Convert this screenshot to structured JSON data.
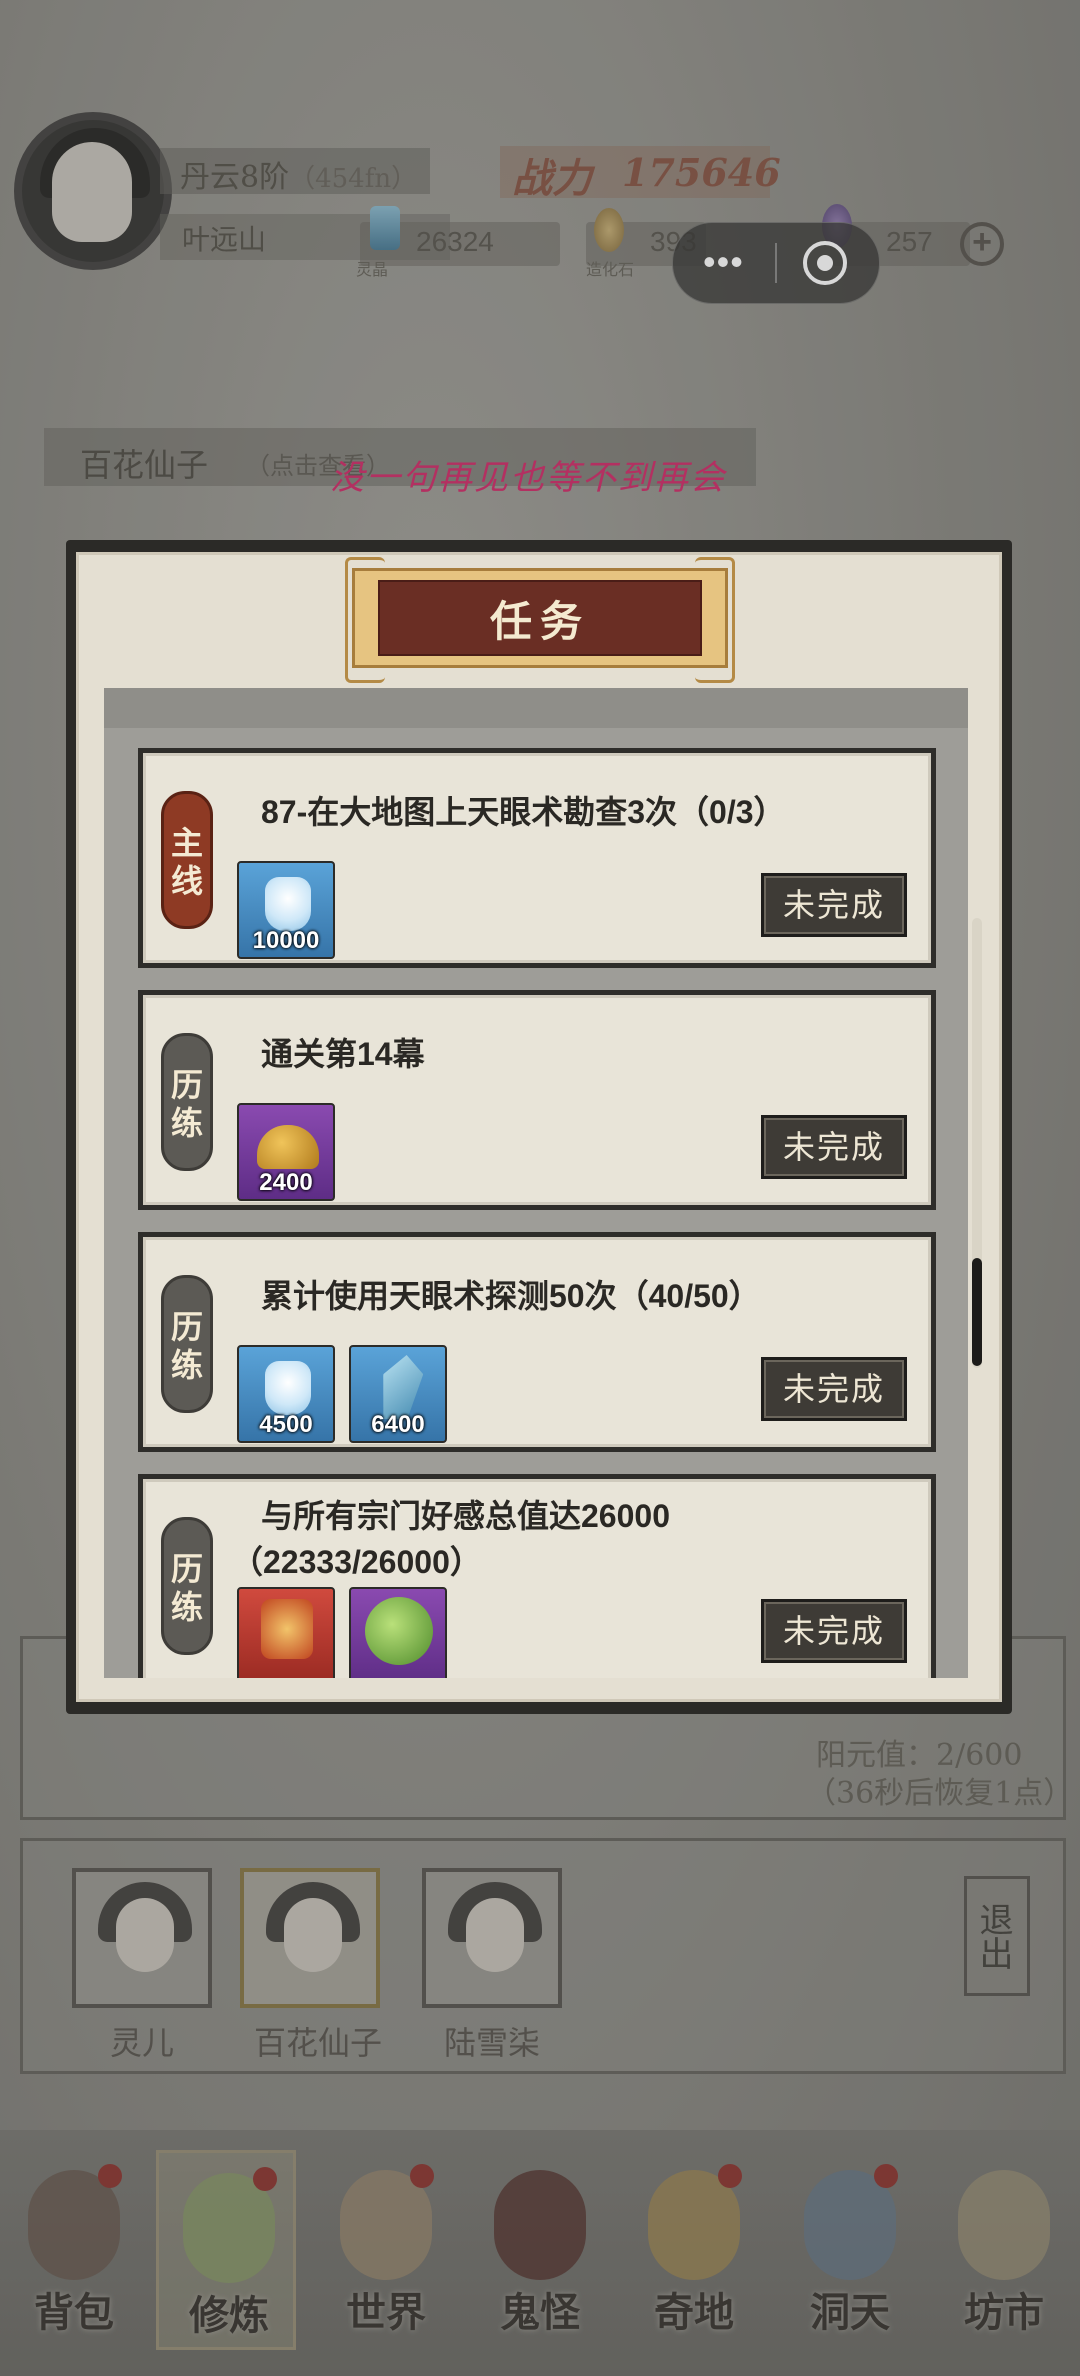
{
  "header": {
    "rank": "丹云8阶",
    "rank_sub": "（454fn）",
    "player_name": "叶远山",
    "power_label": "战力",
    "power_value": "175646",
    "resources": [
      {
        "icon": "spirit-crystal-icon",
        "label": "灵晶",
        "value": "26324"
      },
      {
        "icon": "stone-icon",
        "label": "造化石",
        "value": "393"
      },
      {
        "icon": "gem-icon",
        "label": "",
        "value": "257"
      }
    ]
  },
  "npc": {
    "name": "百花仙子",
    "hint": "（点击查看）",
    "marquee": "没一句再见也等不到再会"
  },
  "background": {
    "yang_value": "阳元值：2/600",
    "recover_hint": "（36秒后恢复1点）",
    "characters": [
      "灵儿",
      "百花仙子",
      "陆雪柒"
    ],
    "exit_label": "退出"
  },
  "modal": {
    "title": "任务",
    "tasks": [
      {
        "tag": "主线",
        "tag_type": "main",
        "title": "87-在大地图上天眼术勘查3次（0/3）",
        "status": "未完成",
        "rewards": [
          {
            "icon": "water-bottle-icon",
            "value": "10000"
          }
        ]
      },
      {
        "tag": "历练",
        "tag_type": "exp",
        "title": "通关第14幕",
        "status": "未完成",
        "rewards": [
          {
            "icon": "golden-helmet-icon",
            "value": "2400"
          }
        ]
      },
      {
        "tag": "历练",
        "tag_type": "exp",
        "title": "累计使用天眼术探测50次（40/50）",
        "status": "未完成",
        "rewards": [
          {
            "icon": "water-bottle-icon",
            "value": "4500"
          },
          {
            "icon": "spirit-crystal-icon",
            "value": "6400"
          }
        ]
      },
      {
        "tag": "历练",
        "tag_type": "exp",
        "title": "与所有宗门好感总值达26000（22333/26000）",
        "status": "未完成",
        "rewards": [
          {
            "icon": "charm-icon",
            "value": ""
          },
          {
            "icon": "green-orb-icon",
            "value": ""
          }
        ]
      }
    ]
  },
  "nav": [
    {
      "label": "背包",
      "badge": true
    },
    {
      "label": "修炼",
      "badge": true
    },
    {
      "label": "世界",
      "badge": true
    },
    {
      "label": "鬼怪",
      "badge": false
    },
    {
      "label": "奇地",
      "badge": true
    },
    {
      "label": "洞天",
      "badge": true
    },
    {
      "label": "坊市",
      "badge": false
    }
  ],
  "colors": {
    "accent_red": "#8e3a24",
    "title_gold": "#e6c481",
    "marquee_pink": "#d2326e",
    "status_dark": "#3e3b36"
  }
}
